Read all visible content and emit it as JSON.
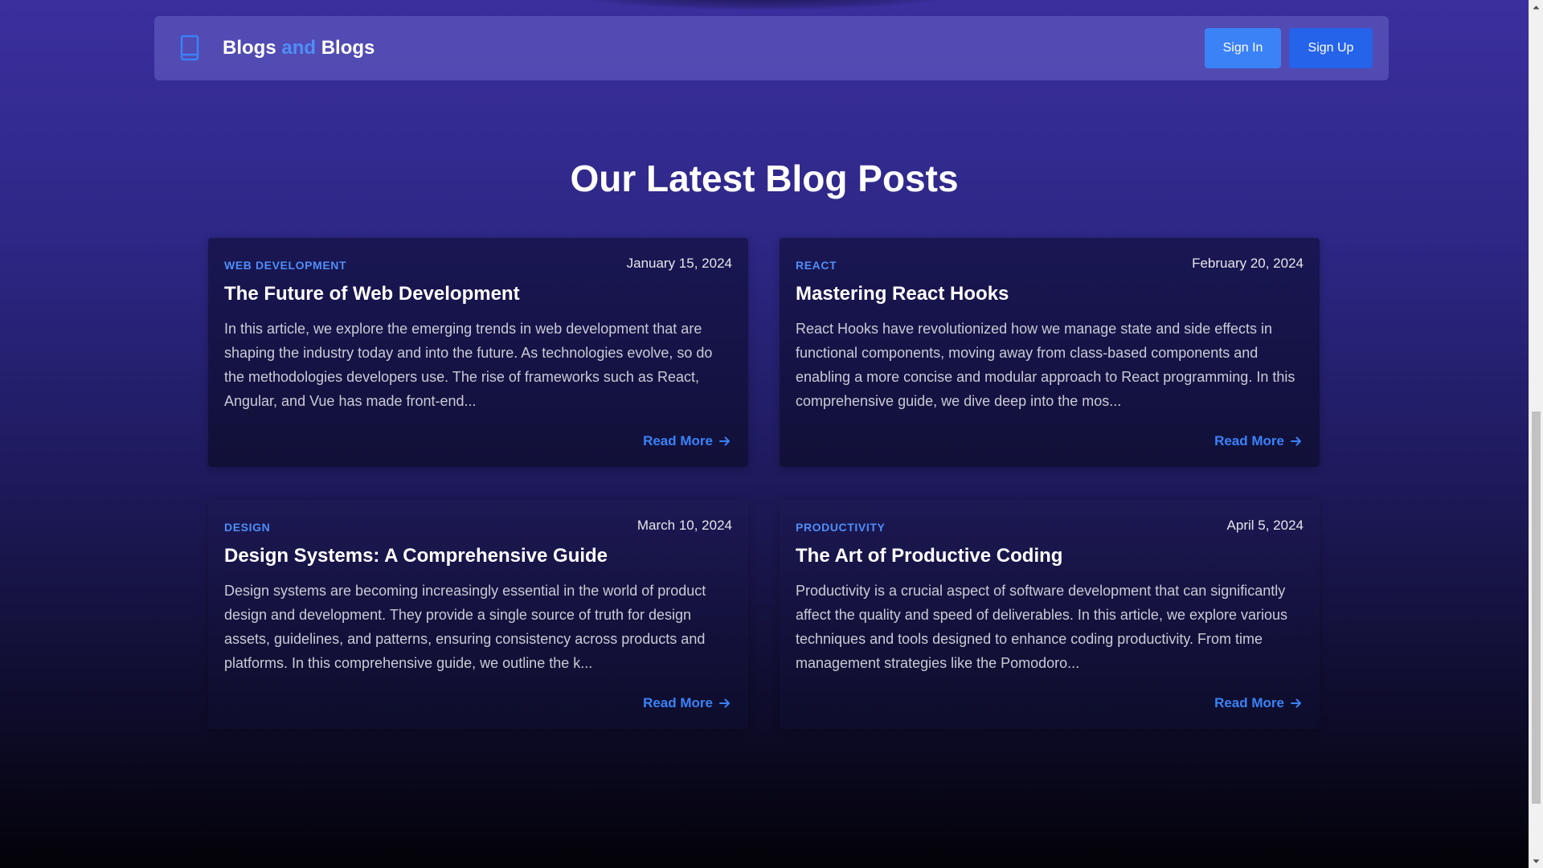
{
  "header": {
    "brand_part1": "Blogs",
    "brand_part2": "and",
    "brand_part3": "Blogs",
    "brand_icon": "book-icon",
    "sign_in_label": "Sign In",
    "sign_up_label": "Sign Up"
  },
  "main": {
    "section_title": "Our Latest Blog Posts",
    "read_more_label": "Read More",
    "posts": [
      {
        "category": "WEB DEVELOPMENT",
        "date": "January 15, 2024",
        "title": "The Future of Web Development",
        "excerpt": "In this article, we explore the emerging trends in web development that are shaping the industry today and into the future. As technologies evolve, so do the methodologies developers use. The rise of frameworks such as React, Angular, and Vue has made front-end..."
      },
      {
        "category": "REACT",
        "date": "February 20, 2024",
        "title": "Mastering React Hooks",
        "excerpt": "React Hooks have revolutionized how we manage state and side effects in functional components, moving away from class-based components and enabling a more concise and modular approach to React programming. In this comprehensive guide, we dive deep into the mos..."
      },
      {
        "category": "DESIGN",
        "date": "March 10, 2024",
        "title": "Design Systems: A Comprehensive Guide",
        "excerpt": "Design systems are becoming increasingly essential in the world of product design and development. They provide a single source of truth for design assets, guidelines, and patterns, ensuring consistency across products and platforms. In this comprehensive guide, we outline the k..."
      },
      {
        "category": "PRODUCTIVITY",
        "date": "April 5, 2024",
        "title": "The Art of Productive Coding",
        "excerpt": "Productivity is a crucial aspect of software development that can significantly affect the quality and speed of deliverables. In this article, we explore various techniques and tools designed to enhance coding productivity. From time management strategies like the Pomodoro..."
      }
    ]
  },
  "colors": {
    "accent": "#4f8ef7",
    "sign_in_bg": "#3b82f6",
    "sign_up_bg": "#2563eb",
    "read_more": "#3b82f6"
  }
}
